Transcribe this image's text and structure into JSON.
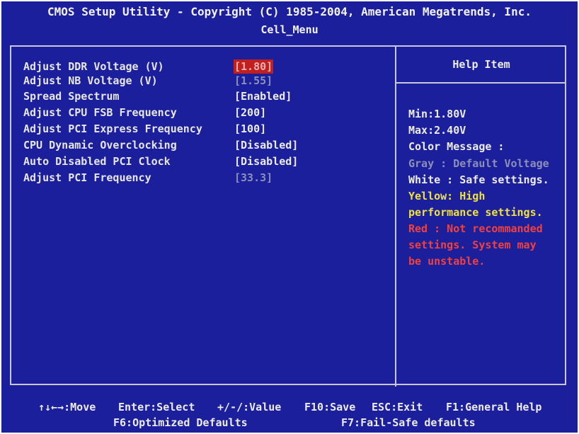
{
  "header": {
    "title": "CMOS Setup Utility - Copyright (C) 1985-2004, American Megatrends, Inc.",
    "subtitle": "Cell_Menu"
  },
  "settings": [
    {
      "label": "Adjust DDR Voltage (V)",
      "value": "[1.80]"
    },
    {
      "label": "Adjust NB Voltage (V)",
      "value": "[1.55]"
    },
    {
      "label": "Spread Spectrum",
      "value": "[Enabled]"
    },
    {
      "label": "Adjust CPU FSB Frequency",
      "value": "[200]"
    },
    {
      "label": "Adjust PCI Express Frequency",
      "value": "[100]"
    },
    {
      "label": "CPU Dynamic Overclocking",
      "value": "[Disabled]"
    },
    {
      "label": "Auto Disabled PCI Clock",
      "value": "[Disabled]"
    },
    {
      "label": "Adjust PCI Frequency",
      "value": "[33.3]"
    }
  ],
  "help": {
    "title": "Help Item",
    "lines": [
      "Min:1.80V",
      "Max:2.40V",
      "Color Message :",
      "Gray : Default Voltage",
      "White : Safe settings.",
      "Yellow: High",
      "performance settings.",
      "Red : Not recommanded",
      "settings. System may",
      "be unstable."
    ]
  },
  "footer": {
    "move": "↑↓←→:Move",
    "select": "Enter:Select",
    "value": "+/-/:Value",
    "save": "F10:Save",
    "exit": "ESC:Exit",
    "general_help": "F1:General Help",
    "optimized": "F6:Optimized Defaults",
    "failsafe": "F7:Fail-Safe defaults"
  },
  "colors": {
    "background": "#1c1f9c",
    "selected": "#c21f1f",
    "gray": "#8c8fb8",
    "yellow": "#f0e040",
    "red": "#f04040"
  }
}
